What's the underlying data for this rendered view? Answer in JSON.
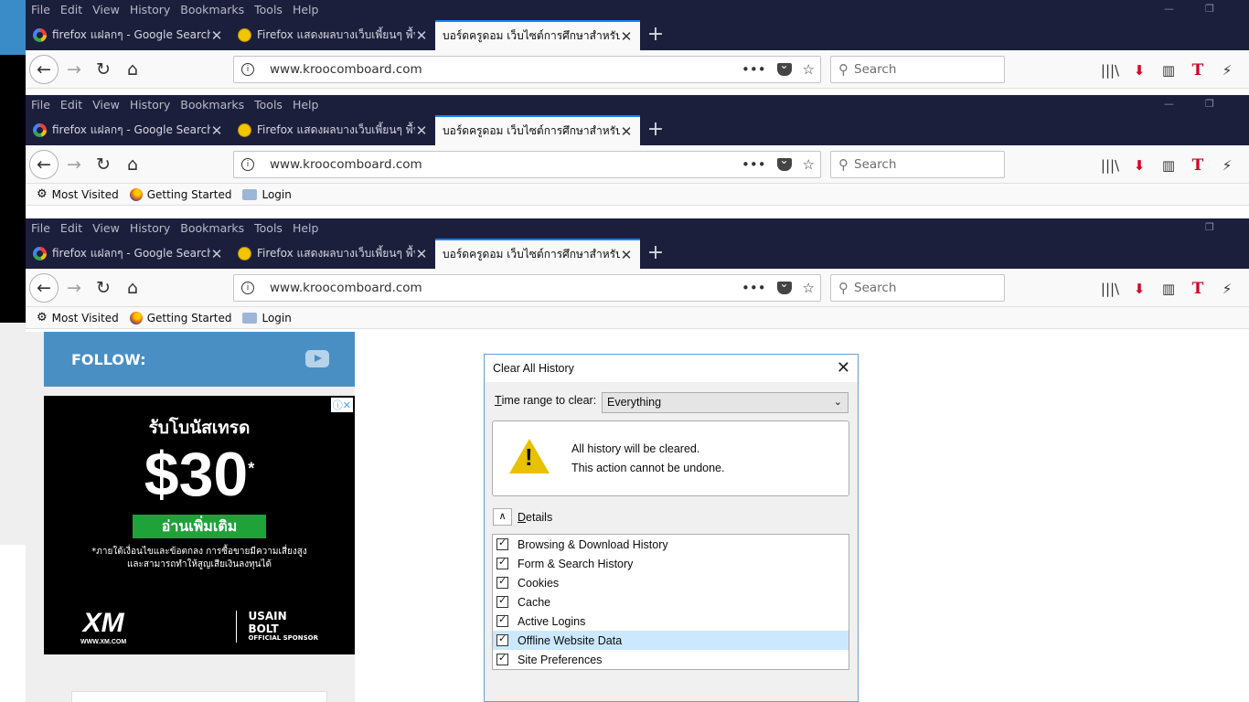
{
  "menu": [
    "File",
    "Edit",
    "View",
    "History",
    "Bookmarks",
    "Tools",
    "Help"
  ],
  "window_controls": {
    "minimize": "—",
    "restore": "❐"
  },
  "tabs": [
    {
      "title": "firefox แฝลกๆ - Google Search",
      "icon": "google-icon"
    },
    {
      "title": "Firefox แสดงผลบางเว็บเพี้ยนๆ พื้นฯ",
      "icon": "yellow-face-icon"
    },
    {
      "title": "บอร์ดครูดอม เว็บไซต์การศึกษาสำหรับครู",
      "icon": "none"
    }
  ],
  "new_tab_label": "+",
  "tab_close": "✕",
  "url": "www.kroocomboard.com",
  "url_info": "i",
  "page_actions": "•••",
  "star": "☆",
  "search_placeholder": "Search",
  "search_glyph": "⚲",
  "nav": {
    "back": "←",
    "forward": "→",
    "reload": "↻",
    "home": "⌂"
  },
  "toolbar_glyphs": {
    "library": "|||\\",
    "downloads": "⬇",
    "sidebar": "▥",
    "t_addon": "T",
    "flash": "⚡"
  },
  "bookmarks": [
    "Most Visited",
    "Getting Started",
    "Login"
  ],
  "bookmark_gear": "⚙",
  "page": {
    "follow_label": "FOLLOW:",
    "ad": {
      "headline": "รับโบนัสเทรด",
      "amount": "$30",
      "asterisk": "*",
      "button": "อ่านเพิ่มเติม",
      "fine_line1": "*ภายใต้เงื่อนไขและข้อตกลง การซื้อขายมีความเสี่ยงสูง",
      "fine_line2": "และสามารถทำให้สูญเสียเงินลงทุนได้",
      "brand": "XM",
      "brand_url": "WWW.XM.COM",
      "sponsor_line1": "USAIN",
      "sponsor_line2": "BOLT",
      "sponsor_line3": "OFFICIAL SPONSOR",
      "ad_controls": "ⓘ✕"
    }
  },
  "dialog": {
    "title": "Clear All History",
    "close": "✕",
    "range_label_u": "T",
    "range_label_rest": "ime range to clear:",
    "range_value": "Everything",
    "range_arrow": "⌄",
    "warning_icon": "!",
    "warning_line1": "All history will be cleared.",
    "warning_line2": "This action cannot be undone.",
    "details_toggle": "∧",
    "details_u": "D",
    "details_rest": "etails",
    "items": [
      {
        "label": "Browsing & Download History",
        "checked": true
      },
      {
        "label": "Form & Search History",
        "checked": true
      },
      {
        "label": "Cookies",
        "checked": true
      },
      {
        "label": "Cache",
        "checked": true
      },
      {
        "label": "Active Logins",
        "checked": true
      },
      {
        "label": "Offline Website Data",
        "checked": true
      },
      {
        "label": "Site Preferences",
        "checked": true
      }
    ]
  }
}
